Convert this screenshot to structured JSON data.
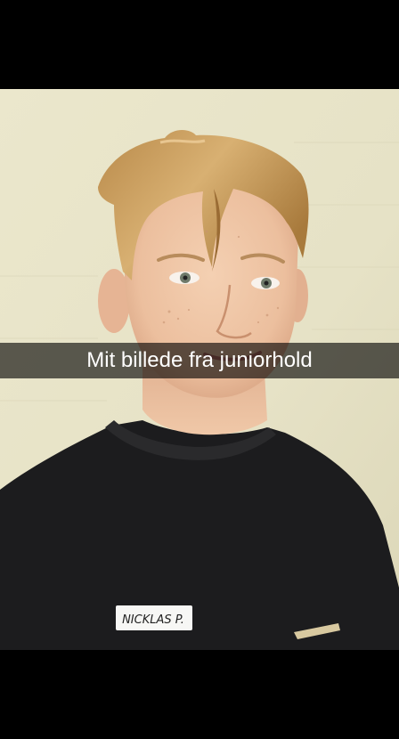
{
  "snap": {
    "caption": "Mit billede fra juniorhold",
    "name_tag": "NICKLAS P."
  },
  "colors": {
    "background": "#000000",
    "wall": "#e8e4c8",
    "skin": "#f0c8a8",
    "hair": "#c89a58",
    "shirt": "#1c1c1e",
    "caption_bar": "rgba(0,0,0,0.62)",
    "caption_text": "#ffffff"
  },
  "icons": {
    "photo": "portrait-photo"
  }
}
